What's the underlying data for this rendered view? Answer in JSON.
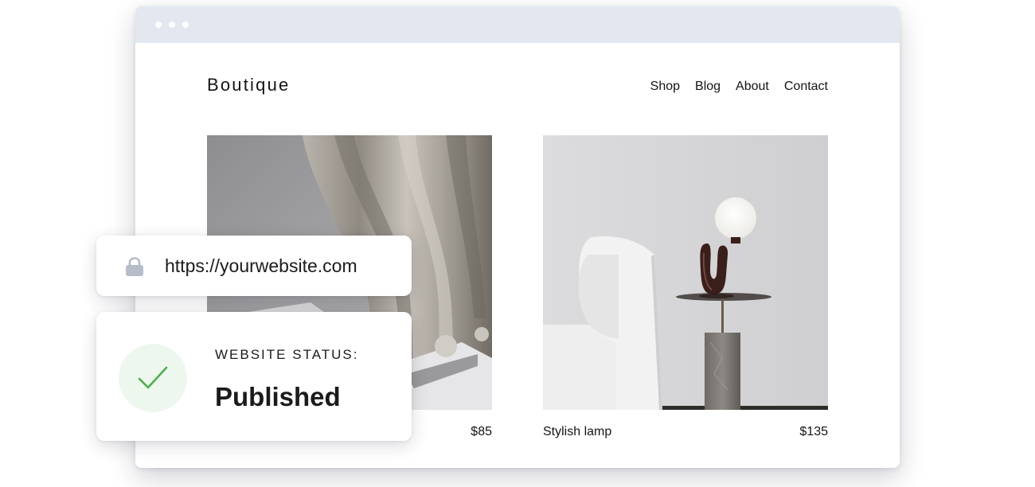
{
  "site": {
    "brand": "Boutique",
    "nav": [
      {
        "label": "Shop"
      },
      {
        "label": "Blog"
      },
      {
        "label": "About"
      },
      {
        "label": "Contact"
      }
    ],
    "products": [
      {
        "name": "",
        "price": "$85",
        "image": "draped-fabric-photo"
      },
      {
        "name": "Stylish lamp",
        "price": "$135",
        "image": "lamp-and-sofa-photo"
      }
    ]
  },
  "url_card": {
    "icon": "lock-icon",
    "url": "https://yourwebsite.com"
  },
  "status_card": {
    "icon": "checkmark-icon",
    "label": "WEBSITE STATUS:",
    "value": "Published"
  },
  "colors": {
    "titlebar": "#e3e7f0",
    "check_bg": "#edf7ee",
    "check_stroke": "#4caf50",
    "lock": "#b6bcc8",
    "text": "#141414"
  }
}
